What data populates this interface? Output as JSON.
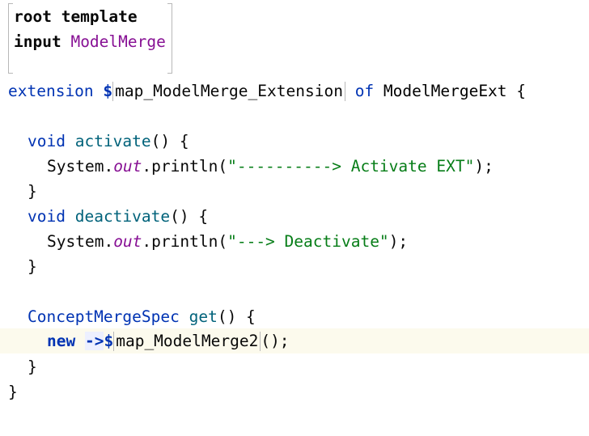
{
  "header": {
    "root_keyword": "root template",
    "input_keyword": "input",
    "input_value": "ModelMerge"
  },
  "code": {
    "ext_keyword": "extension",
    "ext_dollar": "$",
    "ext_ref": "map_ModelMerge_Extension",
    "ext_of": "of",
    "ext_type": "ModelMergeExt",
    "ext_open": "{",
    "void1": "void",
    "activate": "activate",
    "parens_open": "() {",
    "system1": "System.",
    "out1": "out",
    "println1": ".println(",
    "str1": "\"----------> Activate EXT\"",
    "end1": ");",
    "close1": "}",
    "void2": "void",
    "deactivate": "deactivate",
    "parens_open2": "() {",
    "system2": "System.",
    "out2": "out",
    "println2": ".println(",
    "str2": "\"---> Deactivate\"",
    "end2": ");",
    "close2": "}",
    "spec_type": "ConceptMergeSpec",
    "get": "get",
    "parens_open3": "() {",
    "new_kw": "new",
    "arrow": "->",
    "dollar2": "$",
    "ref2": "map_ModelMerge2",
    "call_end": "();",
    "close3": "}",
    "close_ext": "}"
  }
}
